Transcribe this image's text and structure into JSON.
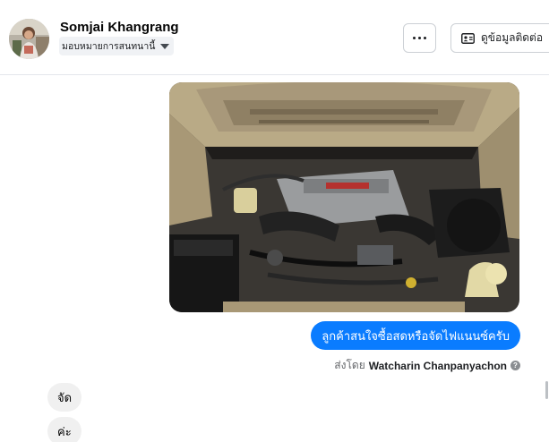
{
  "header": {
    "contact_name": "Somjai Khangrang",
    "assign_label": "มอบหมายการสนทนานี้",
    "contact_info_label": "ดูข้อมูลติดต่อ"
  },
  "messages": {
    "outgoing_text": "ลูกค้าสนใจซื้อสดหรือจัดไฟแนนซ์ครับ",
    "sent_by_prefix": "ส่งโดย",
    "sent_by_name": "Watcharin Chanpanyachon",
    "incoming": [
      "จัด",
      "ค่ะ"
    ]
  },
  "colors": {
    "accent": "#0a7cff",
    "incoming_bubble": "#f0f0f0"
  },
  "icons": {
    "more": "more-horizontal-icon",
    "contact_card": "contact-card-icon",
    "assign_caret": "caret-down-icon",
    "info": "info-circle-icon"
  }
}
